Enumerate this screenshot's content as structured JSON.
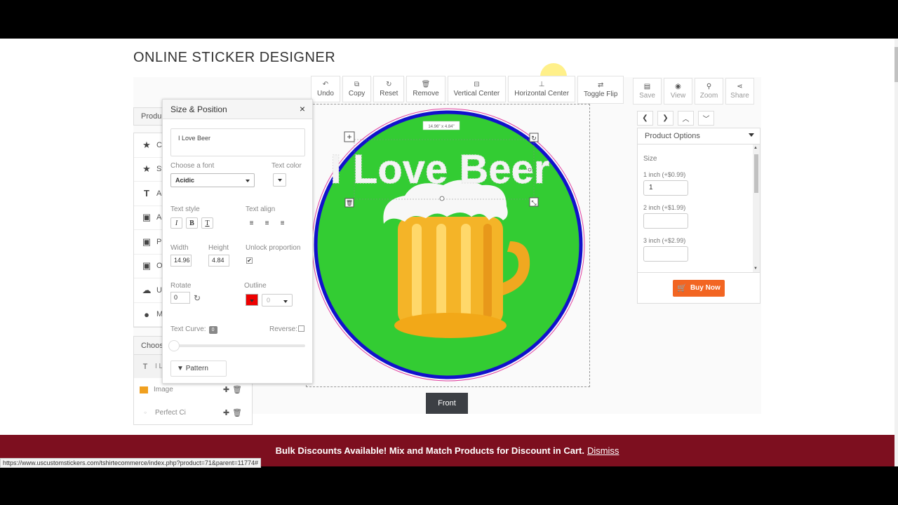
{
  "page": {
    "title": "ONLINE STICKER DESIGNER"
  },
  "toolbar": {
    "undo": "Undo",
    "copy": "Copy",
    "reset": "Reset",
    "remove": "Remove",
    "vertical_center": "Vertical Center",
    "horizontal_center": "Horizontal Center",
    "toggle_flip": "Toggle Flip",
    "save": "Save",
    "view": "View",
    "zoom": "Zoom",
    "share": "Share"
  },
  "left_panel": {
    "header": "Produ",
    "items": [
      "Ca",
      "Sta",
      "Ad",
      "Ad",
      "Pi",
      "Op",
      "Up",
      "My"
    ],
    "layers_header": "Choos",
    "layers": [
      {
        "label": "I L"
      },
      {
        "label": "Image"
      },
      {
        "label": "Perfect Ci"
      }
    ]
  },
  "size_position": {
    "title": "Size & Position",
    "close": "×",
    "text_value": "I Love Beer",
    "choose_font_label": "Choose a font",
    "font_value": "Acidic",
    "text_color_label": "Text color",
    "text_style_label": "Text style",
    "text_align_label": "Text align",
    "italic": "I",
    "bold": "B",
    "underline": "T",
    "width_label": "Width",
    "width_value": "14.96",
    "height_label": "Height",
    "height_value": "4.84",
    "unlock_label": "Unlock proportion",
    "unlock_checked": true,
    "rotate_label": "Rotate",
    "rotate_value": "0",
    "outline_label": "Outline",
    "outline_value": "0",
    "outline_color": "#ee0000",
    "text_curve_label": "Text Curve:",
    "text_curve_value": "0",
    "reverse_label": "Reverse:",
    "reverse_checked": false,
    "pattern_label": "Pattern"
  },
  "design": {
    "selection_size": "14.96\" x 4.84\"",
    "sticker_text": "I Love Beer",
    "circle_fill": "#33cc33",
    "circle_border": "#1111cc",
    "side_button": "Front"
  },
  "product_options": {
    "title": "Product Options",
    "size_label": "Size",
    "options": [
      {
        "label": "1 inch (+$0.99)",
        "value": "1"
      },
      {
        "label": "2 inch (+$1.99)",
        "value": ""
      },
      {
        "label": "3 inch (+$2.99)",
        "value": ""
      }
    ],
    "buy_label": "Buy Now",
    "buy_color": "#f26522"
  },
  "banner": {
    "text": "Bulk Discounts Available! Mix and Match Products for Discount in Cart.",
    "dismiss": "Dismiss",
    "background": "#7d0f1f"
  },
  "status_url": "https://www.uscustomstickers.com/tshirtecommerce/index.php?product=71&parent=11774#"
}
